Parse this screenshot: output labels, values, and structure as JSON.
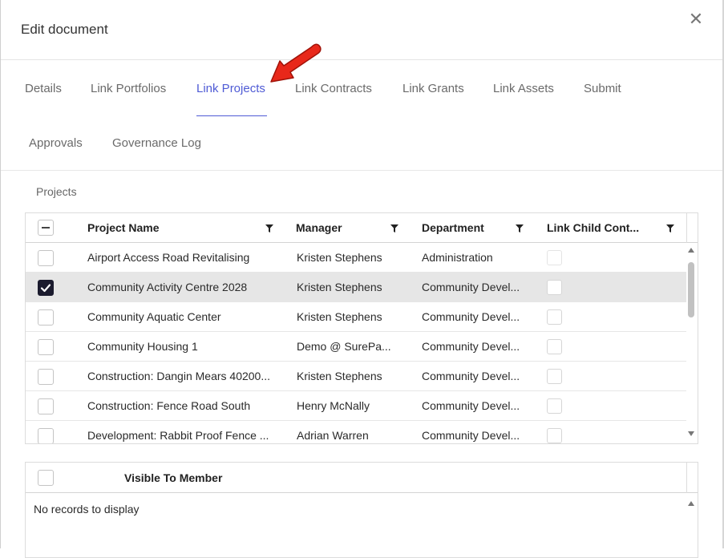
{
  "dialog": {
    "title": "Edit document",
    "close_glyph": "✕"
  },
  "tabs": [
    {
      "label": "Details",
      "active": false
    },
    {
      "label": "Link Portfolios",
      "active": false
    },
    {
      "label": "Link Projects",
      "active": true
    },
    {
      "label": "Link Contracts",
      "active": false
    },
    {
      "label": "Link Grants",
      "active": false
    },
    {
      "label": "Link Assets",
      "active": false
    },
    {
      "label": "Submit",
      "active": false
    },
    {
      "label": "Approvals",
      "active": false
    },
    {
      "label": "Governance Log",
      "active": false
    }
  ],
  "projects": {
    "section_label": "Projects",
    "columns": {
      "name": "Project Name",
      "manager": "Manager",
      "department": "Department",
      "link_child": "Link Child Cont..."
    },
    "rows": [
      {
        "name": "Airport Access Road Revitalising",
        "manager": "Kristen Stephens",
        "department": "Administration",
        "checked": false
      },
      {
        "name": "Community Activity Centre 2028",
        "manager": "Kristen Stephens",
        "department": "Community Devel...",
        "checked": true
      },
      {
        "name": "Community Aquatic Center",
        "manager": "Kristen Stephens",
        "department": "Community Devel...",
        "checked": false
      },
      {
        "name": "Community Housing 1",
        "manager": "Demo @ SurePa...",
        "department": "Community Devel...",
        "checked": false
      },
      {
        "name": "Construction: Dangin Mears 40200...",
        "manager": "Kristen Stephens",
        "department": "Community Devel...",
        "checked": false
      },
      {
        "name": "Construction: Fence Road South",
        "manager": "Henry McNally",
        "department": "Community Devel...",
        "checked": false
      },
      {
        "name": "Development: Rabbit Proof Fence ...",
        "manager": "Adrian Warren",
        "department": "Community Devel...",
        "checked": false
      }
    ]
  },
  "members": {
    "column": "Visible To Member",
    "empty_message": "No records to display"
  },
  "colors": {
    "accent": "#4f5bd5",
    "arrow": "#e8281a",
    "checked_box": "#1b1b2e",
    "selected_row": "#e6e6e6"
  }
}
